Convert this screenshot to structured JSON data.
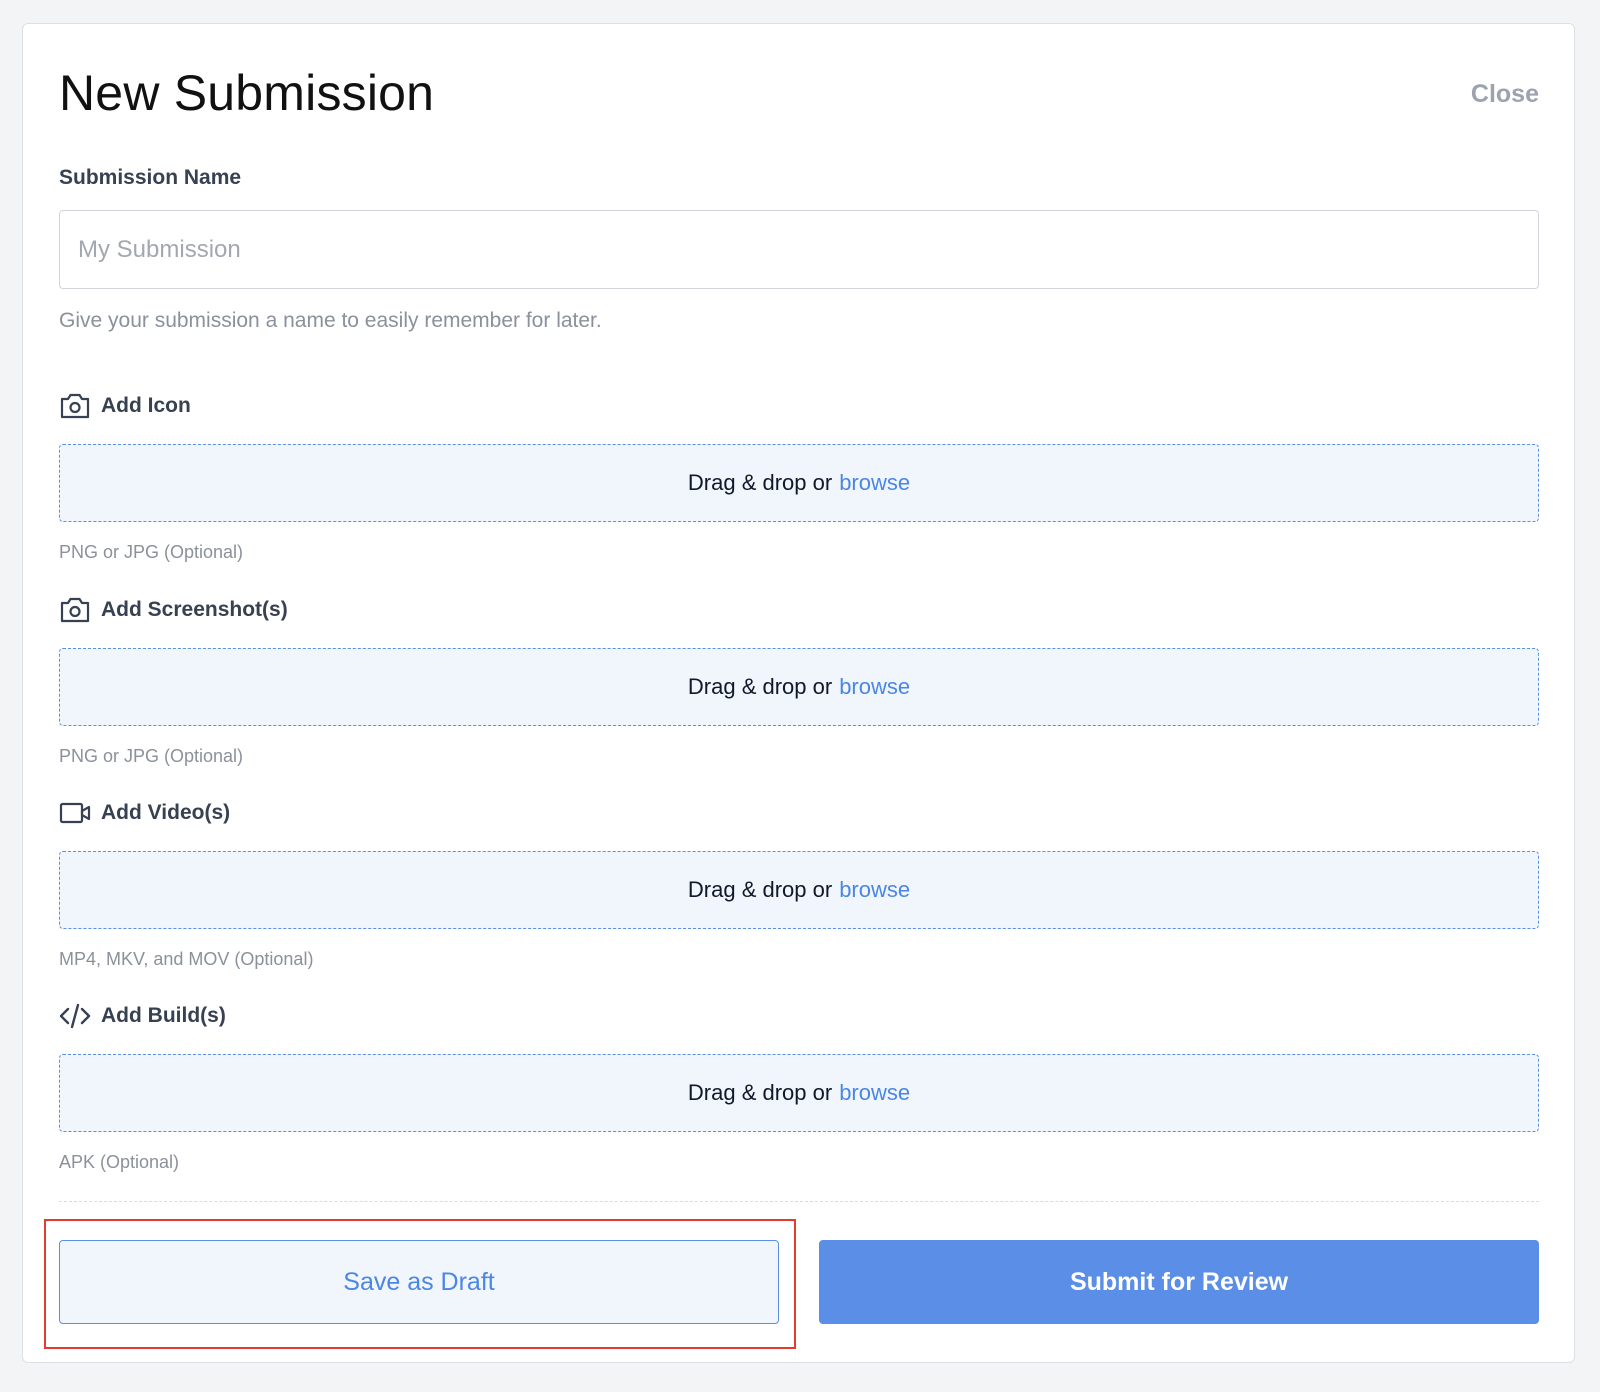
{
  "modal": {
    "title": "New Submission",
    "close_label": "Close"
  },
  "name_field": {
    "label": "Submission Name",
    "placeholder": "My Submission",
    "value": "",
    "help": "Give your submission a name to easily remember for later."
  },
  "uploads": [
    {
      "label": "Add Icon",
      "icon": "camera-icon",
      "drop_text": "Drag & drop or",
      "browse_text": "browse",
      "hint": "PNG or JPG (Optional)"
    },
    {
      "label": "Add Screenshot(s)",
      "icon": "camera-icon",
      "drop_text": "Drag & drop or",
      "browse_text": "browse",
      "hint": "PNG or JPG (Optional)"
    },
    {
      "label": "Add Video(s)",
      "icon": "video-camera-icon",
      "drop_text": "Drag & drop or",
      "browse_text": "browse",
      "hint": "MP4, MKV, and MOV (Optional)"
    },
    {
      "label": "Add Build(s)",
      "icon": "code-icon",
      "drop_text": "Drag & drop or",
      "browse_text": "browse",
      "hint": "APK (Optional)"
    }
  ],
  "actions": {
    "draft_label": "Save as Draft",
    "submit_label": "Submit for Review"
  },
  "colors": {
    "accent": "#5b8ee6",
    "link": "#4a86e4",
    "highlight": "#e33b2e",
    "dropzone_bg": "#f1f6fd"
  }
}
